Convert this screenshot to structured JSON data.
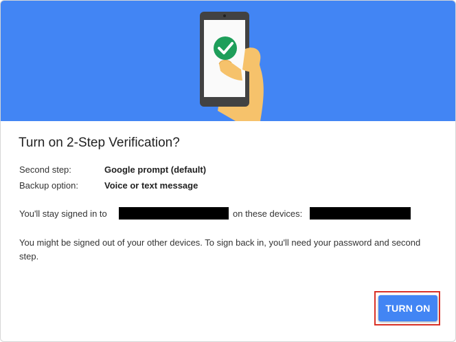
{
  "dialog": {
    "title": "Turn on 2-Step Verification?",
    "details": [
      {
        "label": "Second step:",
        "value": "Google prompt (default)"
      },
      {
        "label": "Backup option:",
        "value": "Voice or text message"
      }
    ],
    "signed_in_prefix": "You'll stay signed in to",
    "signed_in_middle": "on these devices:",
    "signout_notice": "You might be signed out of your other devices. To sign back in, you'll need your password and second step.",
    "turn_on_label": "TURN ON"
  },
  "colors": {
    "hero_bg": "#4285f4",
    "button_bg": "#4285f4",
    "highlight_outline": "#d93025",
    "check_green": "#1e9e5a"
  },
  "icons": {
    "illustration": "phone-in-hand-with-checkmark"
  }
}
